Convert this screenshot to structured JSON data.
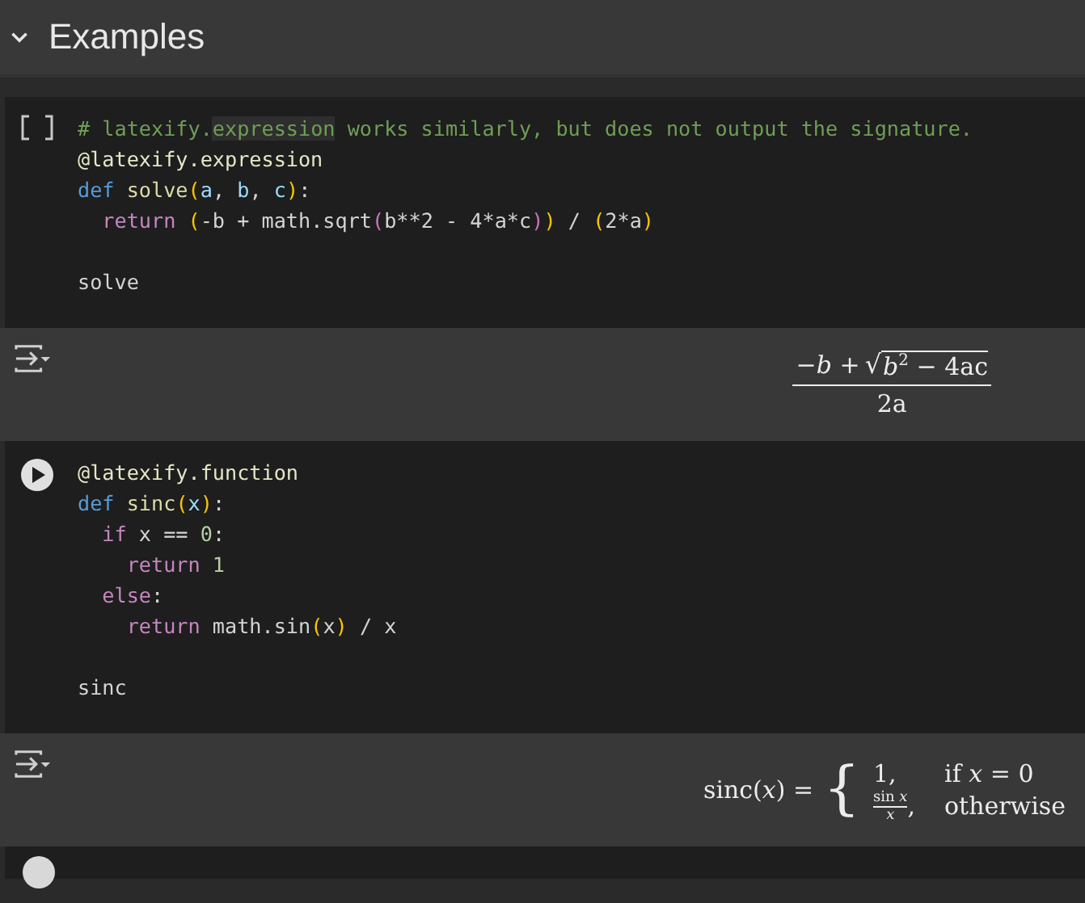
{
  "section": {
    "title": "Examples",
    "expanded": true
  },
  "cells": [
    {
      "hovered": false,
      "lines": [
        {
          "tokens": [
            {
              "kind": "comment",
              "t": "# latexify."
            },
            {
              "kind": "comment-hl",
              "t": "expression"
            },
            {
              "kind": "comment",
              "t": " works similarly, but does not output the signature."
            }
          ]
        },
        {
          "tokens": [
            {
              "kind": "decorator",
              "t": "@latexify.expression"
            }
          ]
        },
        {
          "tokens": [
            {
              "kind": "keyword",
              "t": "def"
            },
            {
              "kind": "fn",
              "t": "solve"
            },
            {
              "kind": "paren",
              "t": "("
            },
            {
              "kind": "param",
              "t": "a"
            },
            {
              "kind": "plain",
              "t": ","
            },
            {
              "kind": "param",
              "t": "b"
            },
            {
              "kind": "plain",
              "t": ","
            },
            {
              "kind": "param",
              "t": "c"
            },
            {
              "kind": "paren",
              "t": ")"
            },
            {
              "kind": "plain",
              "t": ":"
            }
          ],
          "children": [
            {
              "tokens": [
                {
                  "kind": "control",
                  "t": "return"
                },
                {
                  "kind": "paren",
                  "t": "("
                },
                {
                  "kind": "plain",
                  "t": "-b + math.sqrt"
                },
                {
                  "kind": "paren2",
                  "t": "("
                },
                {
                  "kind": "plain",
                  "t": "b**2 - 4*a*c"
                },
                {
                  "kind": "paren2",
                  "t": ")"
                },
                {
                  "kind": "paren",
                  "t": ")"
                },
                {
                  "kind": "plain",
                  "t": "/"
                },
                {
                  "kind": "paren",
                  "t": "("
                },
                {
                  "kind": "plain",
                  "t": "2*a"
                },
                {
                  "kind": "paren",
                  "t": ")"
                }
              ]
            }
          ]
        },
        {
          "blank_before": true,
          "tokens": [
            {
              "kind": "plain",
              "t": "solve"
            }
          ]
        }
      ],
      "output": {
        "kind": "fraction",
        "numerator": "−*b* +",
        "radical": "√",
        "radicand": "*b*$^{2}$ − 4ac",
        "denominator": "2a"
      }
    },
    {
      "hovered": true,
      "lines": [
        {
          "tokens": [
            {
              "kind": "decorator",
              "t": "@latexify.function"
            }
          ]
        },
        {
          "tokens": [
            {
              "kind": "keyword",
              "t": "def"
            },
            {
              "kind": "fn",
              "t": "sinc"
            },
            {
              "kind": "paren",
              "t": "("
            },
            {
              "kind": "param",
              "t": "x"
            },
            {
              "kind": "paren",
              "t": ")"
            },
            {
              "kind": "plain",
              "t": ":"
            }
          ],
          "children": [
            {
              "tokens": [
                {
                  "kind": "control",
                  "t": "if"
                },
                {
                  "kind": "plain",
                  "t": "x =="
                },
                {
                  "kind": "number",
                  "t": "0"
                },
                {
                  "kind": "plain",
                  "t": ":"
                }
              ],
              "children": [
                {
                  "tokens": [
                    {
                      "kind": "control",
                      "t": "return"
                    },
                    {
                      "kind": "number",
                      "t": "1"
                    }
                  ]
                }
              ]
            },
            {
              "tokens": [
                {
                  "kind": "control",
                  "t": "else"
                },
                {
                  "kind": "plain",
                  "t": ":"
                }
              ],
              "children": [
                {
                  "tokens": [
                    {
                      "kind": "control",
                      "t": "return"
                    },
                    {
                      "kind": "plain",
                      "t": "math.sin"
                    },
                    {
                      "kind": "paren",
                      "t": "("
                    },
                    {
                      "kind": "plain",
                      "t": "x"
                    },
                    {
                      "kind": "paren",
                      "t": ")"
                    },
                    {
                      "kind": "plain",
                      "t": "/ x"
                    }
                  ]
                }
              ]
            }
          ]
        },
        {
          "blank_before": true,
          "tokens": [
            {
              "kind": "plain",
              "t": "sinc"
            }
          ]
        }
      ],
      "output": {
        "kind": "piecewise",
        "lhs": "sinc(*x*) =",
        "brace": "{",
        "cases": [
          {
            "value": "1,",
            "condition": "if *x* = 0"
          },
          {
            "value_num": "sin *x*",
            "value_den": "*x*",
            "value_suffix": ",",
            "condition": "otherwise"
          }
        ]
      }
    }
  ]
}
